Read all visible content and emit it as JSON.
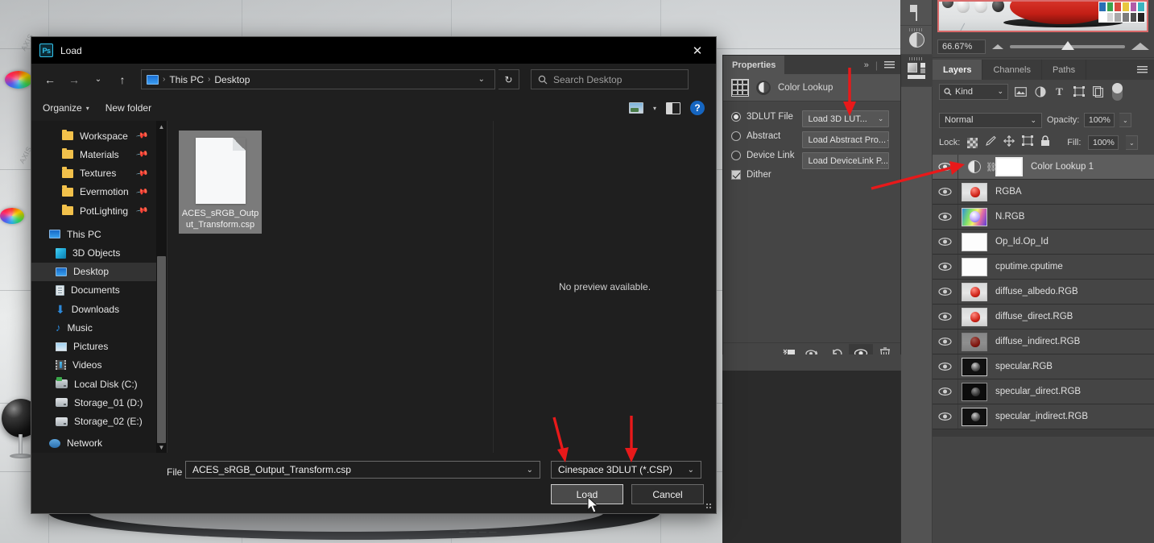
{
  "app": {
    "canvas_zoom": "66.67%"
  },
  "dialog": {
    "title": "Load",
    "app_badge": "Ps",
    "close_icon": "close-icon",
    "nav": {
      "back_icon": "back-arrow-icon",
      "forward_icon": "forward-arrow-icon",
      "recent_icon": "chevron-down-icon",
      "up_icon": "up-arrow-icon",
      "refresh_icon": "refresh-icon",
      "breadcrumb": [
        "This PC",
        "Desktop"
      ],
      "breadcrumb_sep": "›",
      "dropdown_caret": "⌄"
    },
    "search": {
      "placeholder": "Search Desktop",
      "icon": "search-icon"
    },
    "commands": {
      "organize": "Organize",
      "organize_caret": "▾",
      "new_folder": "New folder",
      "view_icon": "view-options-icon",
      "view_caret": "▾",
      "pane_icon": "preview-pane-icon",
      "help_icon": "help-icon"
    },
    "sidebar": [
      {
        "label": "Workspace",
        "icon": "folder-icon",
        "pinned": true,
        "indent": "sub",
        "selected": false
      },
      {
        "label": "Materials",
        "icon": "folder-icon",
        "pinned": true,
        "indent": "sub",
        "selected": false
      },
      {
        "label": "Textures",
        "icon": "folder-icon",
        "pinned": true,
        "indent": "sub",
        "selected": false
      },
      {
        "label": "Evermotion",
        "icon": "folder-icon",
        "pinned": true,
        "indent": "sub",
        "selected": false
      },
      {
        "label": "PotLighting",
        "icon": "folder-icon",
        "pinned": true,
        "indent": "sub",
        "selected": false
      },
      {
        "label": "This PC",
        "icon": "monitor-icon",
        "pinned": false,
        "indent": "root",
        "selected": false
      },
      {
        "label": "3D Objects",
        "icon": "cube-icon",
        "pinned": false,
        "indent": "sub",
        "selected": false
      },
      {
        "label": "Desktop",
        "icon": "desktop-icon",
        "pinned": false,
        "indent": "sub",
        "selected": true
      },
      {
        "label": "Documents",
        "icon": "document-icon",
        "pinned": false,
        "indent": "sub",
        "selected": false
      },
      {
        "label": "Downloads",
        "icon": "download-icon",
        "pinned": false,
        "indent": "sub",
        "selected": false
      },
      {
        "label": "Music",
        "icon": "music-icon",
        "pinned": false,
        "indent": "sub",
        "selected": false
      },
      {
        "label": "Pictures",
        "icon": "picture-icon",
        "pinned": false,
        "indent": "sub",
        "selected": false
      },
      {
        "label": "Videos",
        "icon": "video-icon",
        "pinned": false,
        "indent": "sub",
        "selected": false
      },
      {
        "label": "Local Disk (C:)",
        "icon": "system-disk-icon",
        "pinned": false,
        "indent": "sub",
        "selected": false
      },
      {
        "label": "Storage_01 (D:)",
        "icon": "disk-icon",
        "pinned": false,
        "indent": "sub",
        "selected": false
      },
      {
        "label": "Storage_02 (E:)",
        "icon": "disk-icon",
        "pinned": false,
        "indent": "sub",
        "selected": false
      },
      {
        "label": "Network",
        "icon": "network-icon",
        "pinned": false,
        "indent": "root",
        "selected": false
      }
    ],
    "files": [
      {
        "name": "ACES_sRGB_Output_Transform.csp",
        "display": "ACES_sRGB_Outp\nut_Transform.csp",
        "selected": true
      }
    ],
    "preview": "No preview available.",
    "filename_label": "File name:",
    "filename_value": "ACES_sRGB_Output_Transform.csp",
    "filetype_value": "Cinespace 3DLUT (*.CSP)",
    "load_button": "Load",
    "cancel_button": "Cancel"
  },
  "properties": {
    "tab": "Properties",
    "collapse_icon": "collapse-chevrons-icon",
    "menu_icon": "panel-menu-icon",
    "header_title": "Color Lookup",
    "grid_icon": "lut-grid-icon",
    "adjustment_icon": "adjustment-layer-icon",
    "options": [
      {
        "label": "3DLUT File",
        "selected": true,
        "button": "Load 3D LUT..."
      },
      {
        "label": "Abstract",
        "selected": false,
        "button": "Load Abstract Pro..."
      },
      {
        "label": "Device Link",
        "selected": false,
        "button": "Load DeviceLink P..."
      }
    ],
    "dither_label": "Dither",
    "dither_checked": true,
    "footer_icons": [
      "clip-to-layer-icon",
      "view-previous-state-icon",
      "reset-icon",
      "toggle-visibility-icon",
      "delete-icon"
    ]
  },
  "layers_panel": {
    "tabs": [
      {
        "label": "Layers",
        "selected": true
      },
      {
        "label": "Channels",
        "selected": false
      },
      {
        "label": "Paths",
        "selected": false
      }
    ],
    "menu_icon": "panel-menu-icon",
    "filter": {
      "kind_label": "Kind",
      "search_icon": "search-icon",
      "caret": "⌄",
      "icons": [
        "pixel-layer-filter-icon",
        "adjustment-layer-filter-icon",
        "type-layer-filter-icon",
        "shape-layer-filter-icon",
        "smart-object-filter-icon"
      ],
      "toggle": "filter-enable-toggle"
    },
    "blend_mode": "Normal",
    "opacity_label": "Opacity:",
    "opacity_value": "100%",
    "fill_label": "Fill:",
    "fill_value": "100%",
    "lock_label": "Lock:",
    "lock_icons": [
      "lock-transparent-pixels-icon",
      "lock-image-pixels-icon",
      "lock-position-icon",
      "lock-artboard-icon",
      "lock-all-icon"
    ],
    "layers": [
      {
        "name": "Color Lookup 1",
        "visible": true,
        "selected": true,
        "thumb": "mask",
        "adjustment": true
      },
      {
        "name": "RGBA",
        "visible": true,
        "selected": false,
        "thumb": "red"
      },
      {
        "name": "N.RGB",
        "visible": true,
        "selected": false,
        "thumb": "normal"
      },
      {
        "name": "Op_Id.Op_Id",
        "visible": true,
        "selected": false,
        "thumb": "white"
      },
      {
        "name": "cputime.cputime",
        "visible": true,
        "selected": false,
        "thumb": "white"
      },
      {
        "name": "diffuse_albedo.RGB",
        "visible": true,
        "selected": false,
        "thumb": "red"
      },
      {
        "name": "diffuse_direct.RGB",
        "visible": true,
        "selected": false,
        "thumb": "red"
      },
      {
        "name": "diffuse_indirect.RGB",
        "visible": true,
        "selected": false,
        "thumb": "red"
      },
      {
        "name": "specular.RGB",
        "visible": true,
        "selected": false,
        "thumb": "dark"
      },
      {
        "name": "specular_direct.RGB",
        "visible": true,
        "selected": false,
        "thumb": "dark"
      },
      {
        "name": "specular_indirect.RGB",
        "visible": true,
        "selected": false,
        "thumb": "dark"
      }
    ]
  },
  "annotations": {
    "arrow_color": "#e8191a",
    "arrows": [
      "arrow-to-load-3d-lut-button",
      "arrow-to-color-lookup-layer",
      "arrow-to-load-button",
      "arrow-to-file-type-dropdown"
    ],
    "cursor": "mouse-pointer"
  },
  "icon_dock": {
    "items": [
      "histogram-icon",
      "adjustments-icon",
      "3d-panel-icon"
    ]
  }
}
